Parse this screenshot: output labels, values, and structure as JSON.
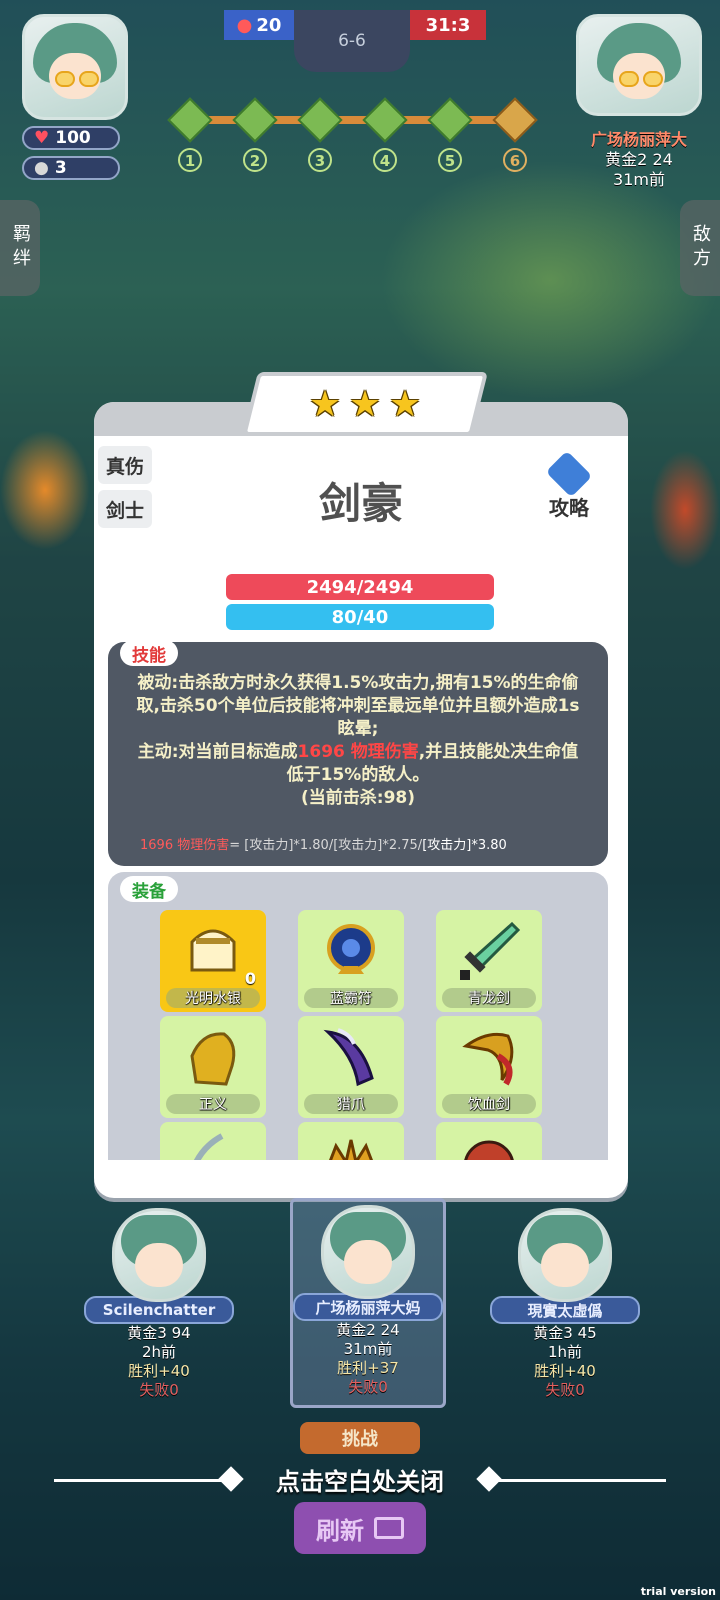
{
  "hud": {
    "player_hp": "100",
    "player_coins": "3",
    "blue_score": "20",
    "stage": "6-6",
    "red_score": "31:3",
    "round_nodes": [
      "1",
      "2",
      "3",
      "4",
      "5",
      "6"
    ],
    "opponent_name": "广场杨丽萍大",
    "opponent_rank": "黄金2 24",
    "opponent_time": "31m前",
    "left_tab": "羁绊",
    "right_tab": "敌方"
  },
  "unit": {
    "stars": [
      "★",
      "★",
      "★"
    ],
    "traits": [
      "真伤",
      "剑士"
    ],
    "name": "剑豪",
    "guide_label": "攻略",
    "hp": "2494/2494",
    "mana": "80/40"
  },
  "skill": {
    "tag": "技能",
    "passive": "被动:击杀敌方时永久获得1.5%攻击力,拥有15%的生命偷取,击杀50个单位后技能将冲刺至最远单位并且额外造成1s眩晕;",
    "active_prefix": "主动:对当前目标造成",
    "active_damage": "1696 物理伤害",
    "active_suffix": ",并且技能处决生命值低于15%的敌人。",
    "kills": "(当前击杀:98)",
    "formula_damage": "1696 物理伤害",
    "formula_rest": "= [攻击力]*1.80/[攻击力]*2.75/",
    "formula_last": "[攻击力]*3.80"
  },
  "equipment": {
    "tag": "装备",
    "items": [
      {
        "name": "光明水银",
        "badge": "0"
      },
      {
        "name": "蓝霸符"
      },
      {
        "name": "青龙剑"
      },
      {
        "name": "正义"
      },
      {
        "name": "猎爪"
      },
      {
        "name": "饮血剑"
      },
      {
        "name": ""
      },
      {
        "name": ""
      },
      {
        "name": ""
      }
    ]
  },
  "players": [
    {
      "name": "Scilenchatter",
      "rank": "黄金3 94",
      "time": "2h前",
      "win": "胜利+40",
      "lose": "失败0"
    },
    {
      "name": "广场杨丽萍大妈",
      "rank": "黄金2 24",
      "time": "31m前",
      "win": "胜利+37",
      "lose": "失败0"
    },
    {
      "name": "現實太虛僞",
      "rank": "黄金3 45",
      "time": "1h前",
      "win": "胜利+40",
      "lose": "失败0"
    }
  ],
  "footer": {
    "challenge": "挑战",
    "close_hint": "点击空白处关闭",
    "refresh": "刷新",
    "watermark": "trial version"
  },
  "colors": {
    "hp_bar": "#ee4a5a",
    "mana_bar": "#34bff0",
    "blue_team": "#3a62c8",
    "red_team": "#c8323a"
  }
}
